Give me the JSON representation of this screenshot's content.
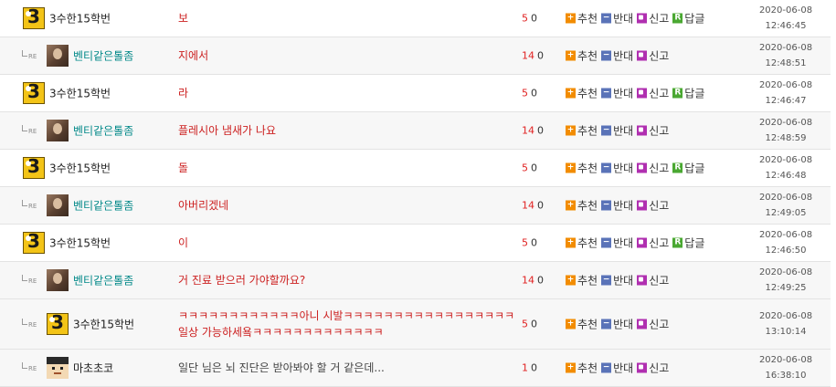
{
  "labels": {
    "re": "RE",
    "recommend": "추천",
    "oppose": "반대",
    "report": "신고",
    "reply": "답글"
  },
  "icons": {
    "recommend": "plus-icon",
    "oppose": "minus-icon",
    "report": "report-icon",
    "reply": "reply-icon",
    "reply_indent": "reply-arrow-icon"
  },
  "colors": {
    "comment_text": "#cc1f1f",
    "reply_nick": "#008888",
    "upvote_count": "#e02020",
    "recommend_icon": "#f28c00",
    "oppose_icon": "#5a73b8",
    "report_icon": "#b02fb0",
    "reply_icon": "#4aa832"
  },
  "comments": [
    {
      "is_reply": false,
      "avatar": "three-badge",
      "nick": "3수한15학번",
      "text": "보",
      "up": "5",
      "down": "0",
      "has_reply_button": true,
      "date": "2020-06-08",
      "time": "12:46:45"
    },
    {
      "is_reply": true,
      "avatar": "photo",
      "nick": "벤티같은톨좀",
      "text": "지에서",
      "up": "14",
      "down": "0",
      "has_reply_button": false,
      "date": "2020-06-08",
      "time": "12:48:51"
    },
    {
      "is_reply": false,
      "avatar": "three-badge",
      "nick": "3수한15학번",
      "text": "라",
      "up": "5",
      "down": "0",
      "has_reply_button": true,
      "date": "2020-06-08",
      "time": "12:46:47"
    },
    {
      "is_reply": true,
      "avatar": "photo",
      "nick": "벤티같은톨좀",
      "text": "플레시아 냄새가 나요",
      "up": "14",
      "down": "0",
      "has_reply_button": false,
      "date": "2020-06-08",
      "time": "12:48:59"
    },
    {
      "is_reply": false,
      "avatar": "three-badge",
      "nick": "3수한15학번",
      "text": "돌",
      "up": "5",
      "down": "0",
      "has_reply_button": true,
      "date": "2020-06-08",
      "time": "12:46:48"
    },
    {
      "is_reply": true,
      "avatar": "photo",
      "nick": "벤티같은톨좀",
      "text": "아버리겠네",
      "up": "14",
      "down": "0",
      "has_reply_button": false,
      "date": "2020-06-08",
      "time": "12:49:05"
    },
    {
      "is_reply": false,
      "avatar": "three-badge",
      "nick": "3수한15학번",
      "text": "이",
      "up": "5",
      "down": "0",
      "has_reply_button": true,
      "date": "2020-06-08",
      "time": "12:46:50"
    },
    {
      "is_reply": true,
      "avatar": "photo",
      "nick": "벤티같은톨좀",
      "text": "거 진료 받으러 가야할까요?",
      "up": "14",
      "down": "0",
      "has_reply_button": false,
      "date": "2020-06-08",
      "time": "12:49:25"
    },
    {
      "is_reply": true,
      "avatar": "three-badge",
      "nick": "3수한15학번",
      "text": "ㅋㅋㅋㅋㅋㅋㅋㅋㅋㅋㅋㅋ아니 시발ㅋㅋㅋㅋㅋㅋㅋㅋㅋㅋㅋㅋㅋㅋㅋㅋㅋ 일상 가능하세욬ㅋㅋㅋㅋㅋㅋㅋㅋㅋㅋㅋㅋㅋ",
      "up": "5",
      "down": "0",
      "has_reply_button": false,
      "date": "2020-06-08",
      "time": "13:10:14"
    },
    {
      "is_reply": true,
      "avatar": "pixel",
      "nick": "마초초코",
      "text": "일단 님은 뇌 진단은 받아봐야 할 거 같은데...",
      "up": "1",
      "down": "0",
      "has_reply_button": false,
      "date": "2020-06-08",
      "time": "16:38:10"
    }
  ]
}
